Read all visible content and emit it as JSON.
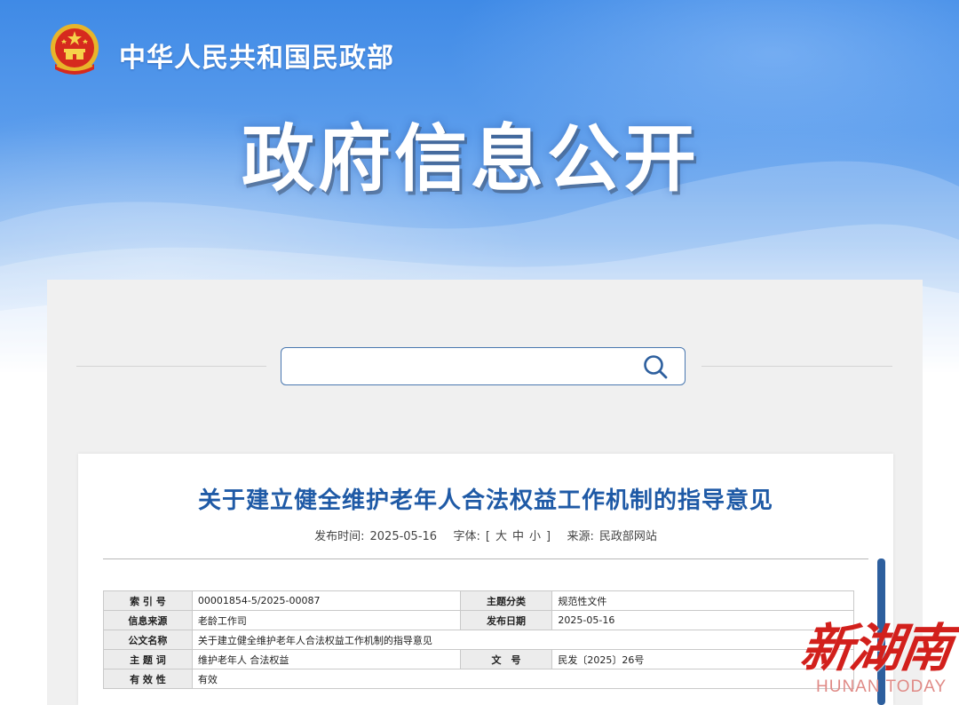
{
  "header": {
    "brand": "中华人民共和国民政部",
    "hero_title": "政府信息公开"
  },
  "search": {
    "placeholder": "",
    "value": ""
  },
  "article": {
    "title": "关于建立健全维护老年人合法权益工作机制的指导意见",
    "meta": {
      "date_label": "发布时间:",
      "date": "2025-05-16",
      "font_label": "字体:",
      "font_open": "[",
      "font_large": "大",
      "font_medium": "中",
      "font_small": "小",
      "font_close": "]",
      "source_label": "来源:",
      "source": "民政部网站"
    },
    "info_table": {
      "index_label": "索 引 号",
      "index_value": "00001854-5/2025-00087",
      "topic_label": "主题分类",
      "topic_value": "规范性文件",
      "origin_label": "信息来源",
      "origin_value": "老龄工作司",
      "pubdate_label": "发布日期",
      "pubdate_value": "2025-05-16",
      "docname_label": "公文名称",
      "docname_value": "关于建立健全维护老年人合法权益工作机制的指导意见",
      "keywords_label": "主 题 词",
      "keywords_value": "维护老年人 合法权益",
      "docno_label": "文　号",
      "docno_value": "民发〔2025〕26号",
      "validity_label": "有 效 性",
      "validity_value": "有效"
    }
  },
  "watermark": {
    "chinese": "新湖南",
    "english": "HUNAN TODAY"
  },
  "colors": {
    "accent_blue": "#1f5aa6",
    "watermark_red": "#d2201c"
  }
}
